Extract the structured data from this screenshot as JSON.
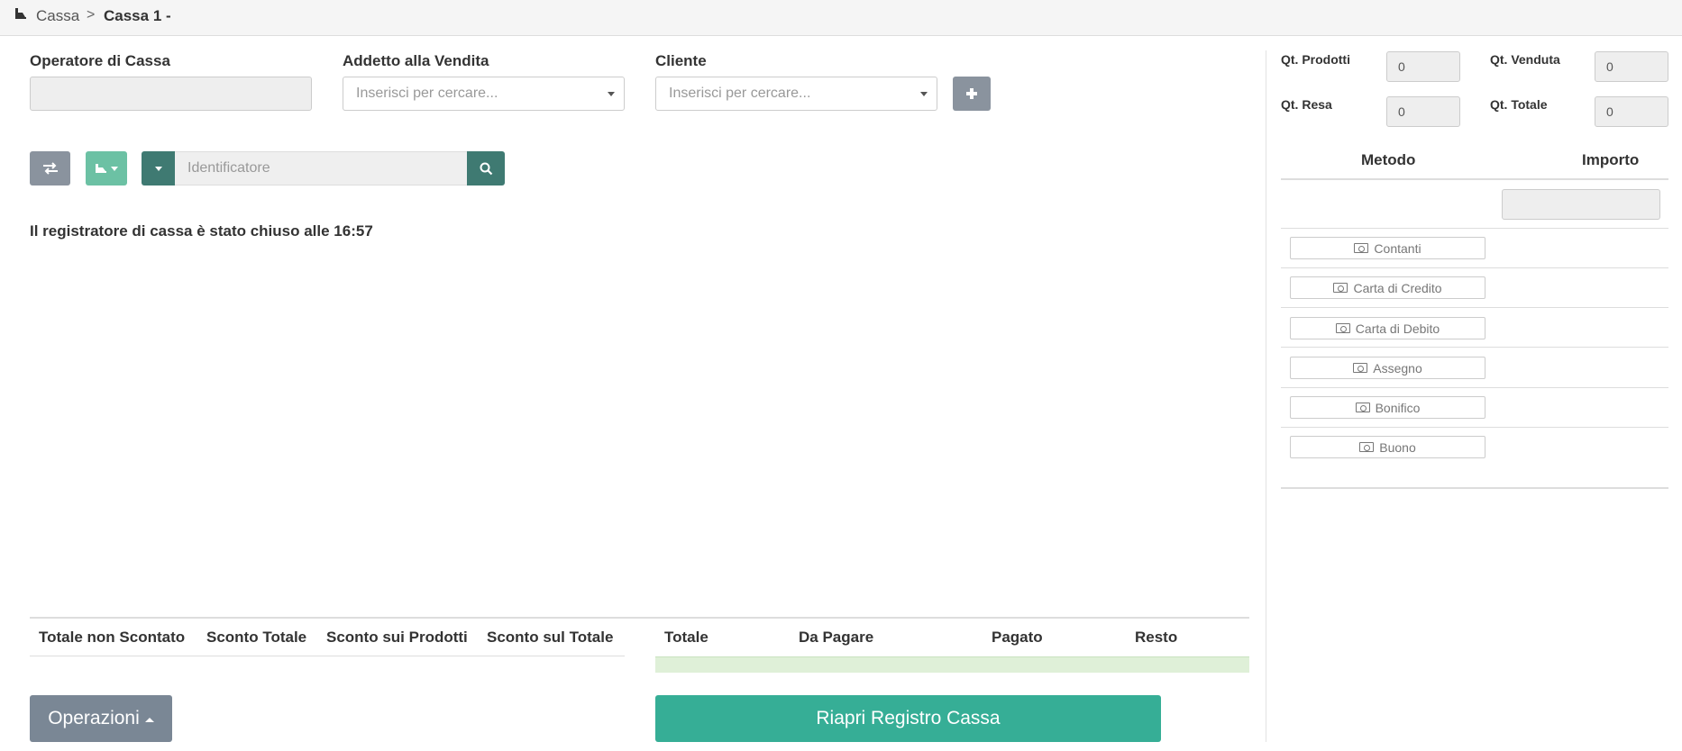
{
  "breadcrumb": {
    "root": "Cassa",
    "separator": ">",
    "current": "Cassa 1 -"
  },
  "form": {
    "operator_label": "Operatore di Cassa",
    "operator_value": "",
    "sales_label": "Addetto alla Vendita",
    "sales_placeholder": "Inserisci per cercare...",
    "customer_label": "Cliente",
    "customer_placeholder": "Inserisci per cercare..."
  },
  "toolbar": {
    "identifier_placeholder": "Identificatore"
  },
  "status_message": "Il registratore di cassa è stato chiuso alle 16:57",
  "totals_left": {
    "headers": [
      "Totale non Scontato",
      "Sconto Totale",
      "Sconto sui Prodotti",
      "Sconto sul Totale"
    ]
  },
  "totals_right": {
    "headers": [
      "Totale",
      "Da Pagare",
      "Pagato",
      "Resto"
    ]
  },
  "buttons": {
    "operations": "Operazioni",
    "reopen": "Riapri Registro Cassa"
  },
  "quantities": {
    "products_label": "Qt. Prodotti",
    "products_value": "0",
    "sold_label": "Qt. Venduta",
    "sold_value": "0",
    "returned_label": "Qt. Resa",
    "returned_value": "0",
    "total_label": "Qt. Totale",
    "total_value": "0"
  },
  "payments": {
    "method_header": "Metodo",
    "amount_header": "Importo",
    "methods": [
      "Contanti",
      "Carta di Credito",
      "Carta di Debito",
      "Assegno",
      "Bonifico",
      "Buono"
    ]
  },
  "colors": {
    "accent": "#36ae96",
    "teal_light": "#6cc1a4",
    "teal_dark": "#3f7a72",
    "gray_button": "#7a8795"
  }
}
